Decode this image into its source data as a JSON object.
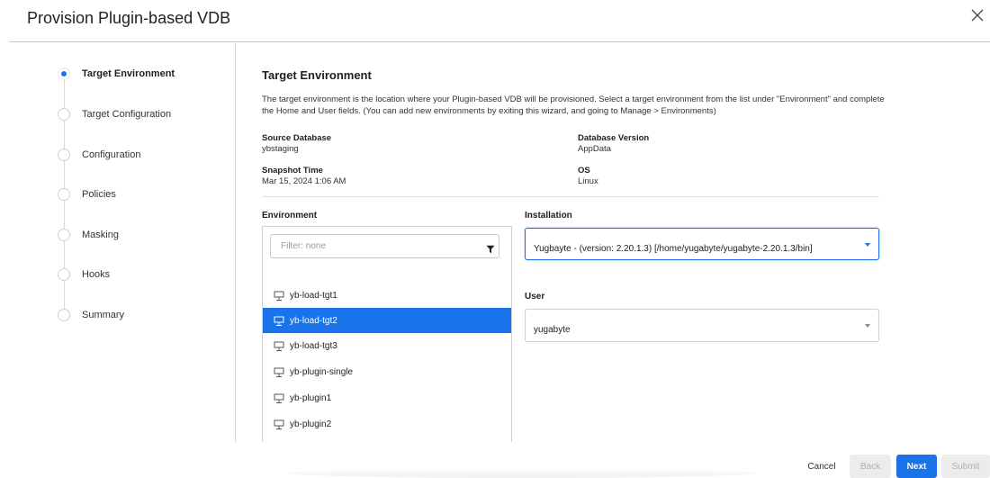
{
  "dialog": {
    "title": "Provision Plugin-based VDB"
  },
  "steps": [
    {
      "label": "Target Environment",
      "active": true
    },
    {
      "label": "Target Configuration",
      "active": false
    },
    {
      "label": "Configuration",
      "active": false
    },
    {
      "label": "Policies",
      "active": false
    },
    {
      "label": "Masking",
      "active": false
    },
    {
      "label": "Hooks",
      "active": false
    },
    {
      "label": "Summary",
      "active": false
    }
  ],
  "main": {
    "heading": "Target Environment",
    "description": "The target environment is the location where your Plugin-based VDB will be provisioned. Select a target environment from the list under \"Environment\" and complete the Home and User fields. (You can add new environments by exiting this wizard, and going to Manage > Environments)",
    "info": {
      "source_db_label": "Source Database",
      "source_db_value": "ybstaging",
      "db_version_label": "Database Version",
      "db_version_value": "AppData",
      "snapshot_time_label": "Snapshot Time",
      "snapshot_time_value": "Mar 15, 2024 1:06 AM",
      "os_label": "OS",
      "os_value": "Linux"
    }
  },
  "environment": {
    "label": "Environment",
    "filter_placeholder": "Filter: none",
    "items": [
      {
        "name": "yb-load-tgt1",
        "selected": false
      },
      {
        "name": "yb-load-tgt2",
        "selected": true
      },
      {
        "name": "yb-load-tgt3",
        "selected": false
      },
      {
        "name": "yb-plugin-single",
        "selected": false
      },
      {
        "name": "yb-plugin1",
        "selected": false
      },
      {
        "name": "yb-plugin2",
        "selected": false
      }
    ]
  },
  "installation": {
    "label": "Installation",
    "value": "Yugbayte - (version: 2.20.1.3) [/home/yugabyte/yugabyte-2.20.1.3/bin]"
  },
  "user": {
    "label": "User",
    "value": "yugabyte"
  },
  "footer": {
    "cancel": "Cancel",
    "back": "Back",
    "next": "Next",
    "submit": "Submit"
  },
  "colors": {
    "accent": "#1a73e8",
    "disabled_bg": "#ececec",
    "disabled_text": "#b0b0b0"
  },
  "icons": {
    "close": "close-icon",
    "filter": "filter-icon",
    "environment": "monitor-icon",
    "dropdown": "caret-down-icon"
  }
}
